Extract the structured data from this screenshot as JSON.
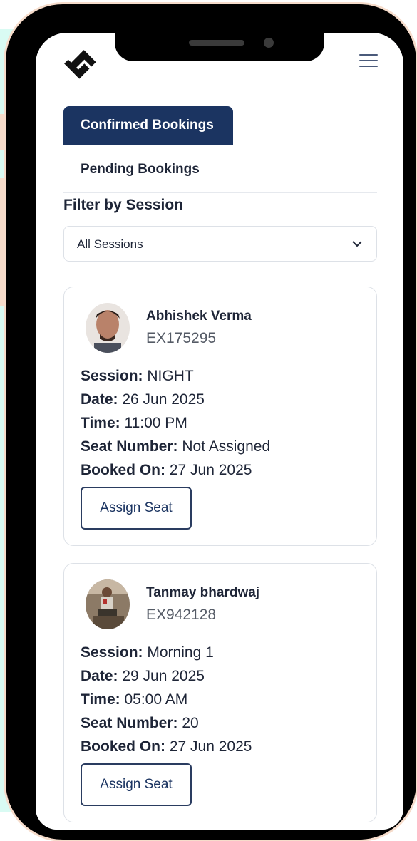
{
  "tabs": {
    "confirmed_label": "Confirmed Bookings",
    "pending_label": "Pending Bookings"
  },
  "filter": {
    "label": "Filter by Session",
    "selected": "All Sessions"
  },
  "labels": {
    "session": "Session:",
    "date": "Date:",
    "time": "Time:",
    "seat": "Seat Number:",
    "booked_on": "Booked On:"
  },
  "bookings": [
    {
      "name": "Abhishek Verma",
      "code": "EX175295",
      "session": "NIGHT",
      "date": "26 Jun 2025",
      "time": "11:00 PM",
      "seat": "Not Assigned",
      "booked_on": "27 Jun 2025",
      "button": "Assign Seat"
    },
    {
      "name": "Tanmay bhardwaj",
      "code": "EX942128",
      "session": "Morning 1",
      "date": "29 Jun 2025",
      "time": "05:00 AM",
      "seat": "20",
      "booked_on": "27 Jun 2025",
      "button": "Assign Seat"
    }
  ],
  "icons": {
    "logo": "brand-logo-icon",
    "menu": "hamburger-menu-icon",
    "chevron": "chevron-down-icon"
  },
  "colors": {
    "accent": "#1b3461",
    "text": "#1e2537",
    "muted": "#555b66",
    "border": "#dde1e7"
  }
}
